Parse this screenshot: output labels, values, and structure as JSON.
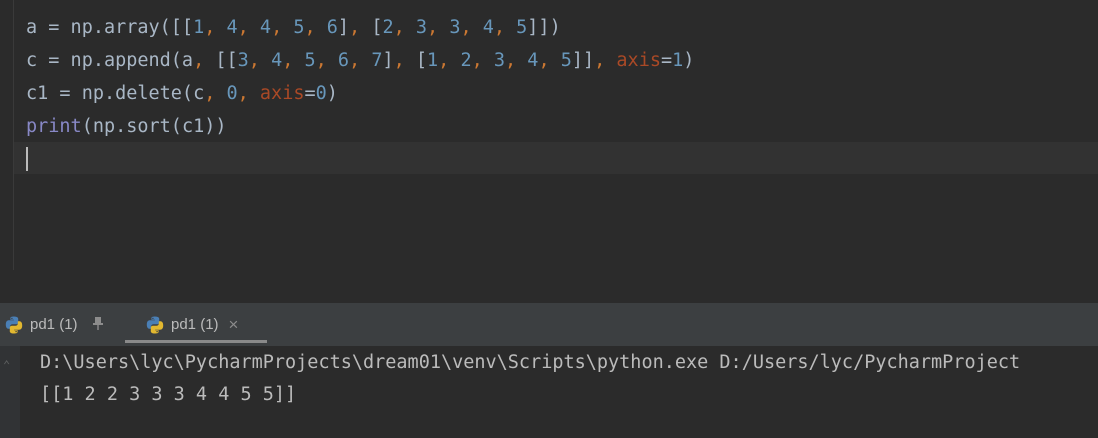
{
  "editor": {
    "line1": [
      {
        "t": "a = np.array([[",
        "c": ""
      },
      {
        "t": "1",
        "c": "t-num"
      },
      {
        "t": ", ",
        "c": "t-com"
      },
      {
        "t": "4",
        "c": "t-num"
      },
      {
        "t": ", ",
        "c": "t-com"
      },
      {
        "t": "4",
        "c": "t-num"
      },
      {
        "t": ", ",
        "c": "t-com"
      },
      {
        "t": "5",
        "c": "t-num"
      },
      {
        "t": ", ",
        "c": "t-com"
      },
      {
        "t": "6",
        "c": "t-num"
      },
      {
        "t": "]",
        "c": ""
      },
      {
        "t": ", ",
        "c": "t-com"
      },
      {
        "t": "[",
        "c": ""
      },
      {
        "t": "2",
        "c": "t-num"
      },
      {
        "t": ", ",
        "c": "t-com"
      },
      {
        "t": "3",
        "c": "t-num"
      },
      {
        "t": ", ",
        "c": "t-com"
      },
      {
        "t": "3",
        "c": "t-num"
      },
      {
        "t": ", ",
        "c": "t-com"
      },
      {
        "t": "4",
        "c": "t-num"
      },
      {
        "t": ", ",
        "c": "t-com"
      },
      {
        "t": "5",
        "c": "t-num"
      },
      {
        "t": "]])",
        "c": ""
      }
    ],
    "line2": [
      {
        "t": "c = np.append(a",
        "c": ""
      },
      {
        "t": ", ",
        "c": "t-com"
      },
      {
        "t": "[[",
        "c": ""
      },
      {
        "t": "3",
        "c": "t-num"
      },
      {
        "t": ", ",
        "c": "t-com"
      },
      {
        "t": "4",
        "c": "t-num"
      },
      {
        "t": ", ",
        "c": "t-com"
      },
      {
        "t": "5",
        "c": "t-num"
      },
      {
        "t": ", ",
        "c": "t-com"
      },
      {
        "t": "6",
        "c": "t-num"
      },
      {
        "t": ", ",
        "c": "t-com"
      },
      {
        "t": "7",
        "c": "t-num"
      },
      {
        "t": "]",
        "c": ""
      },
      {
        "t": ", ",
        "c": "t-com"
      },
      {
        "t": "[",
        "c": ""
      },
      {
        "t": "1",
        "c": "t-num"
      },
      {
        "t": ", ",
        "c": "t-com"
      },
      {
        "t": "2",
        "c": "t-num"
      },
      {
        "t": ", ",
        "c": "t-com"
      },
      {
        "t": "3",
        "c": "t-num"
      },
      {
        "t": ", ",
        "c": "t-com"
      },
      {
        "t": "4",
        "c": "t-num"
      },
      {
        "t": ", ",
        "c": "t-com"
      },
      {
        "t": "5",
        "c": "t-num"
      },
      {
        "t": "]]",
        "c": ""
      },
      {
        "t": ", ",
        "c": "t-com"
      },
      {
        "t": "axis",
        "c": "t-kw"
      },
      {
        "t": "=",
        "c": ""
      },
      {
        "t": "1",
        "c": "t-num"
      },
      {
        "t": ")",
        "c": ""
      }
    ],
    "line3": [
      {
        "t": "c1 = np.delete(c",
        "c": ""
      },
      {
        "t": ", ",
        "c": "t-com"
      },
      {
        "t": "0",
        "c": "t-num"
      },
      {
        "t": ", ",
        "c": "t-com"
      },
      {
        "t": "axis",
        "c": "t-kw"
      },
      {
        "t": "=",
        "c": ""
      },
      {
        "t": "0",
        "c": "t-num"
      },
      {
        "t": ")",
        "c": ""
      }
    ],
    "line4": [
      {
        "t": "print",
        "c": "t-bi"
      },
      {
        "t": "(np.sort(c1))",
        "c": ""
      }
    ]
  },
  "tabs": {
    "tab1_label": "pd1 (1)",
    "tab2_label": "pd1 (1)",
    "pin_glyph": "▼",
    "close_glyph": "×"
  },
  "console": {
    "command": "D:\\Users\\lyc\\PycharmProjects\\dream01\\venv\\Scripts\\python.exe D:/Users/lyc/PycharmProject",
    "output": "[[1 2 2 3 3 3 4 4 5 5]]"
  },
  "colors": {
    "number": "#6897bb",
    "comma": "#cc7832",
    "keyword_arg": "#aa4926",
    "builtin": "#8888c6",
    "text": "#a9b7c6"
  },
  "icons": {
    "python": "python-icon",
    "pin": "pin-icon",
    "close": "close-icon"
  }
}
